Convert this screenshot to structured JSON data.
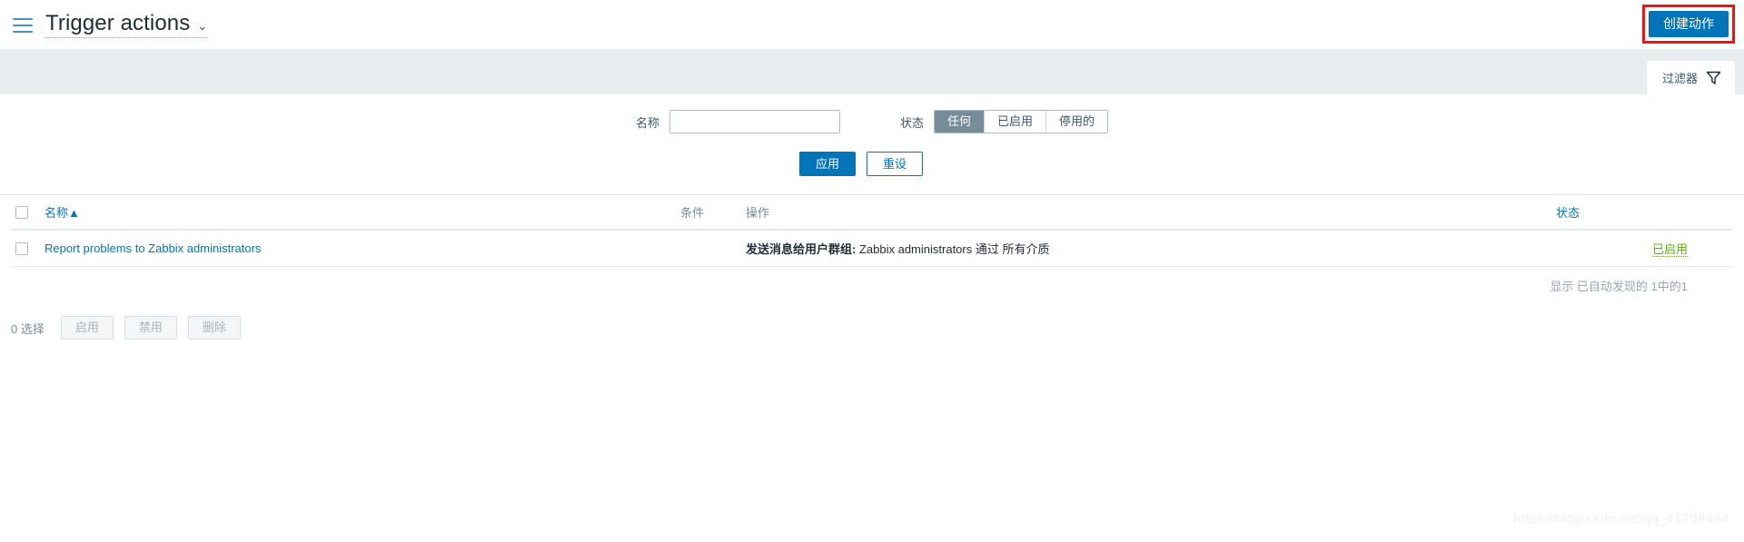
{
  "header": {
    "menu_icon": "hamburger-icon",
    "title": "Trigger actions",
    "title_chevron": "⌄",
    "create_button": "创建动作"
  },
  "filter": {
    "tab_label": "过滤器",
    "tab_icon": "funnel-icon",
    "name_label": "名称",
    "name_value": "",
    "name_placeholder": "",
    "status_label": "状态",
    "status_options": [
      "任何",
      "已启用",
      "停用的"
    ],
    "status_selected": "任何",
    "apply_label": "应用",
    "reset_label": "重设"
  },
  "table": {
    "columns": {
      "name": "名称",
      "sort_indicator": "▲",
      "conditions": "条件",
      "operations": "操作",
      "status": "状态"
    },
    "rows": [
      {
        "name": "Report problems to Zabbix administrators",
        "conditions": "",
        "operation_label": "发送消息给用户群组:",
        "operation_value": "Zabbix administrators 通过 所有介质",
        "status": "已启用"
      }
    ],
    "footer": "显示 已自动发现的 1中的1"
  },
  "action_bar": {
    "selected_text": "0 选择",
    "enable_label": "启用",
    "disable_label": "禁用",
    "delete_label": "删除"
  },
  "watermark": "https://blog.csdn.net/qq_41709494",
  "colors": {
    "accent": "#0275b8",
    "status_enabled": "#59b300",
    "annotation": "#fb1010",
    "segment_active": "#768d99"
  }
}
